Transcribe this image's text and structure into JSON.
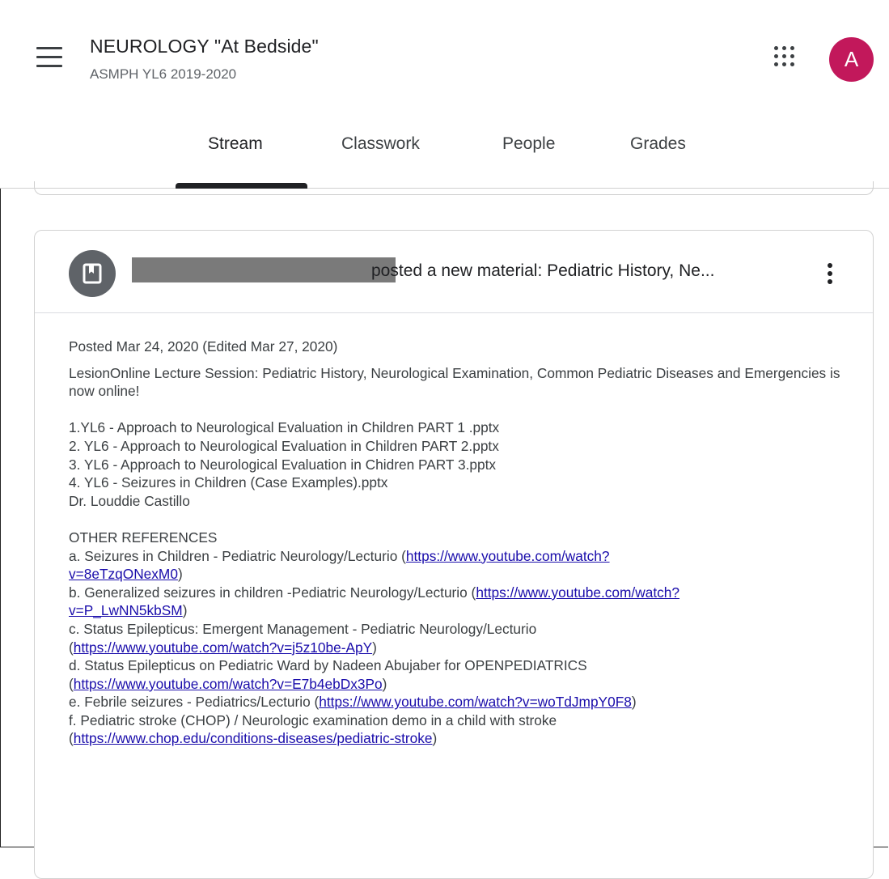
{
  "header": {
    "title": "NEUROLOGY \"At Bedside\"",
    "subtitle": "ASMPH YL6 2019-2020",
    "avatar_letter": "A"
  },
  "tabs": [
    {
      "label": "Stream",
      "active": true
    },
    {
      "label": "Classwork",
      "active": false
    },
    {
      "label": "People",
      "active": false
    },
    {
      "label": "Grades",
      "active": false
    }
  ],
  "post": {
    "headline": "posted a new material: Pediatric History, Ne...",
    "meta": "Posted Mar 24, 2020 (Edited Mar 27, 2020)",
    "intro": "LesionOnline Lecture Session: Pediatric History, Neurological Examination, Common Pediatric Diseases and Emergencies is now online!",
    "files": [
      "1.YL6 - Approach to Neurological Evaluation in Children PART 1 .pptx",
      "2. YL6 - Approach to Neurological Evaluation in Children PART 2.pptx",
      "3. YL6 - Approach to Neurological Evaluation in Chidren PART 3.pptx",
      "4. YL6 - Seizures in Children (Case Examples).pptx"
    ],
    "author": "Dr. Louddie Castillo",
    "refs_heading": "OTHER REFERENCES",
    "refs": [
      {
        "text": "a. Seizures in Children - Pediatric Neurology/Lecturio (",
        "link1": "https://www.youtube.com/watch?",
        "link2": "v=8eTzqONexM0",
        "close": ")"
      },
      {
        "text": "b. Generalized seizures in children -Pediatric Neurology/Lecturio (",
        "link1": "https://www.youtube.com/watch?",
        "link2": "v=P_LwNN5kbSM",
        "close": ")"
      },
      {
        "text": "c. Status Epilepticus: Emergent Management - Pediatric Neurology/Lecturio",
        "link1": "https://www.youtube.com/watch?v=j5z10be-ApY",
        "close": ")"
      },
      {
        "text": "d. Status Epilepticus on Pediatric Ward by Nadeen Abujaber for OPENPEDIATRICS",
        "link1": "https://www.youtube.com/watch?v=E7b4ebDx3Po",
        "close": ")"
      },
      {
        "text": "e. Febrile seizures - Pediatrics/Lecturio (",
        "link1": "https://www.youtube.com/watch?v=woTdJmpY0F8",
        "close": ")"
      },
      {
        "text": "f. Pediatric stroke (CHOP) / Neurologic examination demo in a child with stroke",
        "link1": "https://www.chop.edu/conditions-diseases/pediatric-stroke",
        "close": ")"
      }
    ]
  },
  "colors": {
    "avatar": "#c2185b",
    "link": "#1a0dab",
    "tab_indicator": "#202124"
  }
}
